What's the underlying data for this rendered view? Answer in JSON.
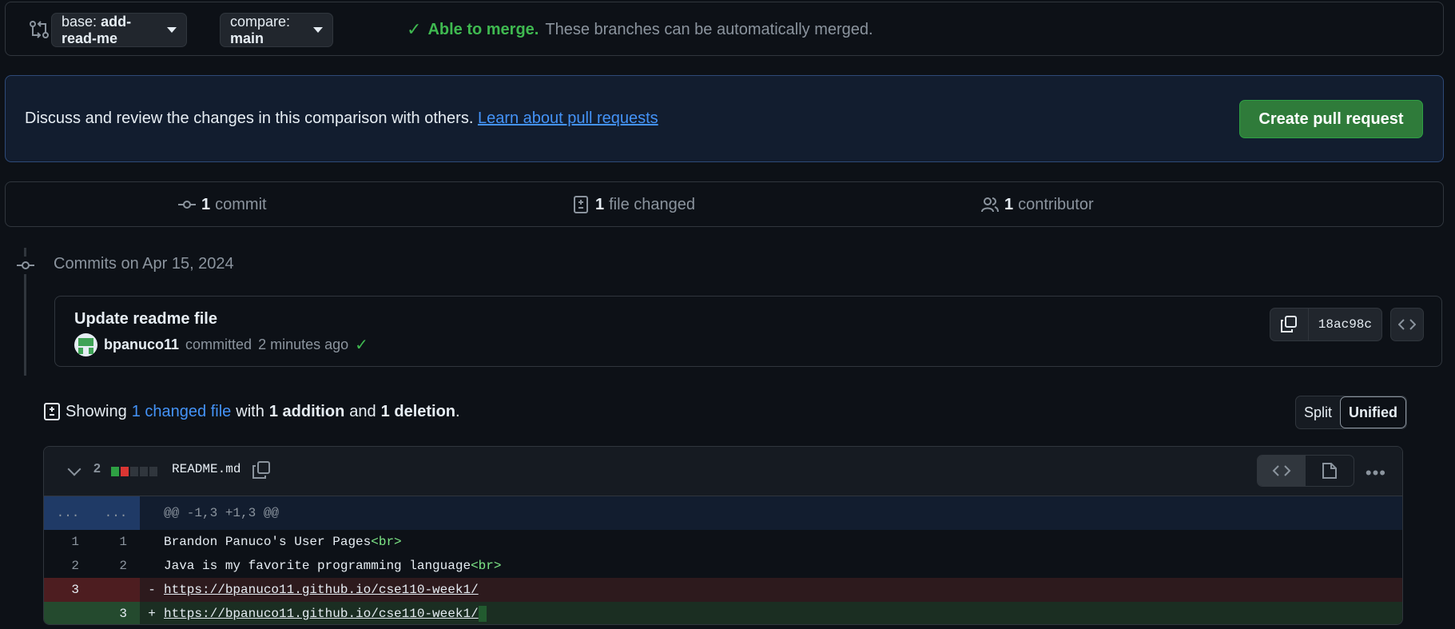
{
  "range": {
    "base_prefix": "base:",
    "base_branch": "add-read-me",
    "compare_prefix": "compare:",
    "compare_branch": "main",
    "arrow": "←",
    "dots": "...",
    "merge_ok": "Able to merge.",
    "merge_desc": "These branches can be automatically merged."
  },
  "blurb": {
    "text": "Discuss and review the changes in this comparison with others.",
    "link": "Learn about pull requests",
    "button": "Create pull request"
  },
  "stats": {
    "commits_count": "1",
    "commits_label": "commit",
    "files_count": "1",
    "files_label": "file changed",
    "contributors_count": "1",
    "contributors_label": "contributor"
  },
  "commits": {
    "date_header": "Commits on Apr 15, 2024",
    "items": [
      {
        "title": "Update readme file",
        "author": "bpanuco11",
        "action": "committed",
        "time": "2 minutes ago",
        "sha": "18ac98c"
      }
    ]
  },
  "diff_summary": {
    "showing": "Showing",
    "changed": "1 changed file",
    "with": "with",
    "additions": "1 addition",
    "and": "and",
    "deletions": "1 deletion",
    "period": ".",
    "split_label": "Split",
    "unified_label": "Unified"
  },
  "file": {
    "count": "2",
    "name": "README.md",
    "hunk_left": "...",
    "hunk_right": "...",
    "hunk_header": "@@ -1,3 +1,3 @@",
    "lines": [
      {
        "type": "ctx",
        "old": "1",
        "new": "1",
        "text": "Brandon Panuco's User Pages",
        "tag": "<br>"
      },
      {
        "type": "ctx",
        "old": "2",
        "new": "2",
        "text": "Java is my favorite programming language",
        "tag": "<br>"
      },
      {
        "type": "del",
        "old": "3",
        "new": "",
        "mark": "-",
        "text": "https://bpanuco11.github.io/cse110-week1/"
      },
      {
        "type": "add",
        "old": "",
        "new": "3",
        "mark": "+",
        "text": "https://bpanuco11.github.io/cse110-week1/"
      }
    ]
  },
  "colors": {
    "accent": "#4493f8",
    "success": "#3fb950",
    "button_green": "#2f7b3a",
    "deletion": "#da3633",
    "addition": "#2ea043"
  }
}
